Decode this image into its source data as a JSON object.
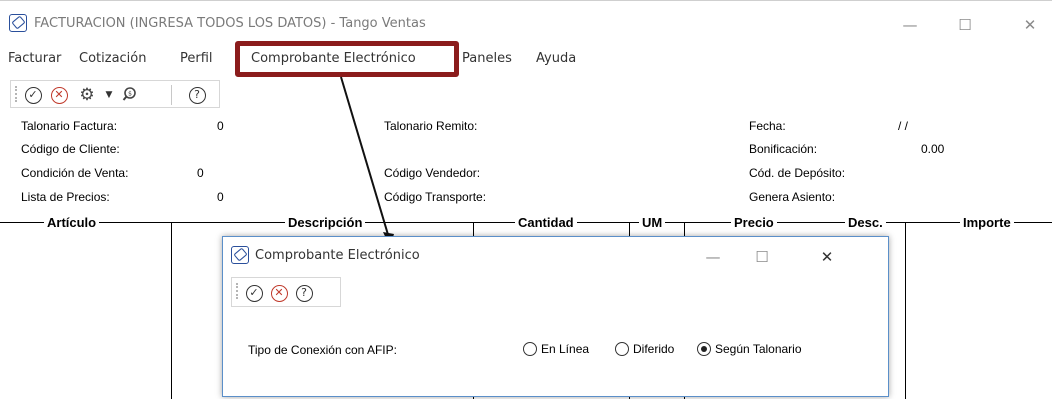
{
  "window": {
    "title": "FACTURACION (INGRESA TODOS LOS DATOS) - Tango Ventas",
    "minimize": "—",
    "maximize": "☐",
    "close": "✕"
  },
  "menu": {
    "items": [
      "Facturar",
      "Cotización",
      "Perfil",
      "Comprobante Electrónico",
      "Paneles",
      "Ayuda"
    ],
    "highlight_color": "#8b1c1c"
  },
  "toolbar": {
    "icons": [
      "ok-icon",
      "cancel-icon",
      "settings-icon",
      "dropdown-arrow-icon",
      "search-icon",
      "help-icon"
    ]
  },
  "form": {
    "talonario_factura": {
      "label": "Talonario Factura:",
      "value": "0"
    },
    "codigo_cliente": {
      "label": "Código de Cliente:",
      "value": ""
    },
    "condicion_venta": {
      "label": "Condición de Venta:",
      "value": "0"
    },
    "lista_precios": {
      "label": "Lista de Precios:",
      "value": "0"
    },
    "talonario_remito": {
      "label": "Talonario Remito:",
      "value": ""
    },
    "codigo_vendedor": {
      "label": "Código Vendedor:",
      "value": ""
    },
    "codigo_transporte": {
      "label": "Código Transporte:",
      "value": ""
    },
    "fecha": {
      "label": "Fecha:",
      "value": "/ /"
    },
    "bonificacion": {
      "label": "Bonificación:",
      "value": "0.00"
    },
    "cod_deposito": {
      "label": "Cód. de Depósito:",
      "value": ""
    },
    "genera_asiento": {
      "label": "Genera Asiento:",
      "value": ""
    }
  },
  "grid": {
    "columns": [
      "Artículo",
      "Descripción",
      "Cantidad",
      "UM",
      "Precio",
      "Desc.",
      "Importe"
    ]
  },
  "dialog": {
    "title": "Comprobante Electrónico",
    "minimize": "—",
    "maximize": "☐",
    "close": "✕",
    "field_label": "Tipo de Conexión con AFIP:",
    "options": [
      {
        "label": "En Línea",
        "selected": false
      },
      {
        "label": "Diferido",
        "selected": false
      },
      {
        "label": "Según Talonario",
        "selected": true
      }
    ],
    "border_color": "#5b8fc9"
  }
}
